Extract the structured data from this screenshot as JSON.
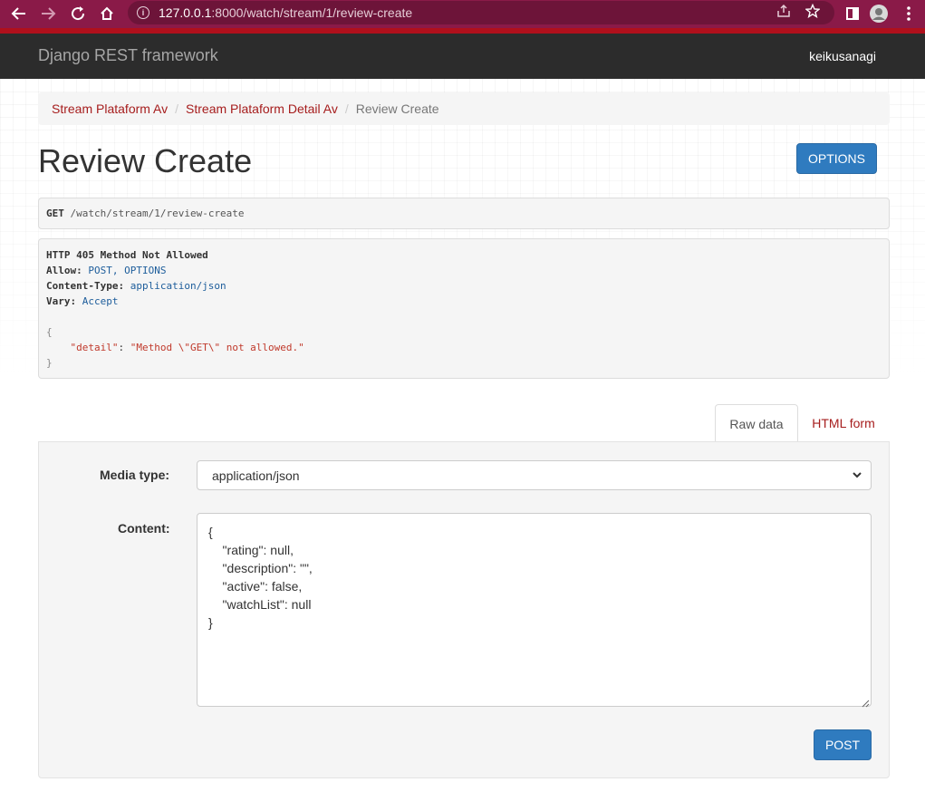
{
  "browser": {
    "url_host": "127.0.0.1",
    "url_rest": ":8000/watch/stream/1/review-create"
  },
  "navbar": {
    "brand": "Django REST framework",
    "username": "keikusanagi"
  },
  "breadcrumb": {
    "items": [
      "Stream Plataform Av",
      "Stream Plataform Detail Av"
    ],
    "active": "Review Create",
    "separator": "/"
  },
  "page": {
    "title": "Review Create",
    "options_label": "OPTIONS"
  },
  "request": {
    "method": "GET",
    "path": " /watch/stream/1/review-create"
  },
  "response": {
    "status": "HTTP 405 Method Not Allowed",
    "headers": [
      {
        "name": "Allow:",
        "value": " POST, OPTIONS"
      },
      {
        "name": "Content-Type:",
        "value": " application/json"
      },
      {
        "name": "Vary:",
        "value": " Accept"
      }
    ],
    "body_open": "{",
    "body_key": "\"detail\"",
    "body_colon": ": ",
    "body_value": "\"Method \\\"GET\\\" not allowed.\"",
    "body_close": "}"
  },
  "tabs": {
    "raw": "Raw data",
    "html": "HTML form"
  },
  "form": {
    "media_label": "Media type:",
    "media_value": "application/json",
    "content_label": "Content:",
    "content_value": "{\n    \"rating\": null,\n    \"description\": \"\",\n    \"active\": false,\n    \"watchList\": null\n}",
    "post_label": "POST"
  },
  "colors": {
    "browser_frame": "#8a1a48",
    "navbar": "#2c2c2c",
    "primary_button": "#2f7bbf",
    "link": "#a61d1d"
  }
}
